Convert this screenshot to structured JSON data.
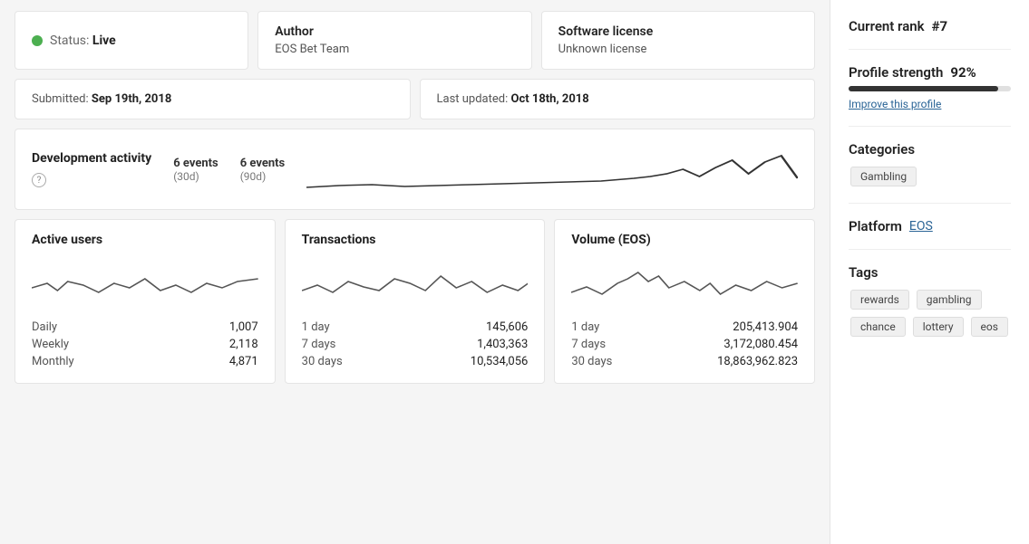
{
  "status": {
    "label": "Status:",
    "value": "Live"
  },
  "author": {
    "title": "Author",
    "value": "EOS Bet Team"
  },
  "license": {
    "title": "Software license",
    "value": "Unknown license"
  },
  "submitted": {
    "label": "Submitted:",
    "value": "Sep 19th, 2018"
  },
  "last_updated": {
    "label": "Last updated:",
    "value": "Oct 18th, 2018"
  },
  "dev_activity": {
    "title": "Development activity",
    "events_30d_count": "6 events",
    "events_30d_label": "(30d)",
    "events_90d_count": "6 events",
    "events_90d_label": "(90d)"
  },
  "active_users": {
    "title": "Active users",
    "rows": [
      {
        "period": "Daily",
        "value": "1,007"
      },
      {
        "period": "Weekly",
        "value": "2,118"
      },
      {
        "period": "Monthly",
        "value": "4,871"
      }
    ]
  },
  "transactions": {
    "title": "Transactions",
    "rows": [
      {
        "period": "1 day",
        "value": "145,606"
      },
      {
        "period": "7 days",
        "value": "1,403,363"
      },
      {
        "period": "30 days",
        "value": "10,534,056"
      }
    ]
  },
  "volume": {
    "title": "Volume (EOS)",
    "rows": [
      {
        "period": "1 day",
        "value": "205,413.904"
      },
      {
        "period": "7 days",
        "value": "3,172,080.454"
      },
      {
        "period": "30 days",
        "value": "18,863,962.823"
      }
    ]
  },
  "sidebar": {
    "current_rank_label": "Current rank",
    "current_rank_value": "#7",
    "profile_strength_label": "Profile strength",
    "profile_strength_pct": "92%",
    "profile_strength_value": 92,
    "improve_link": "Improve this profile",
    "categories_label": "Categories",
    "categories": [
      "Gambling"
    ],
    "platform_label": "Platform",
    "platform_value": "EOS",
    "tags_label": "Tags",
    "tags": [
      "rewards",
      "gambling",
      "chance",
      "lottery",
      "eos"
    ]
  }
}
